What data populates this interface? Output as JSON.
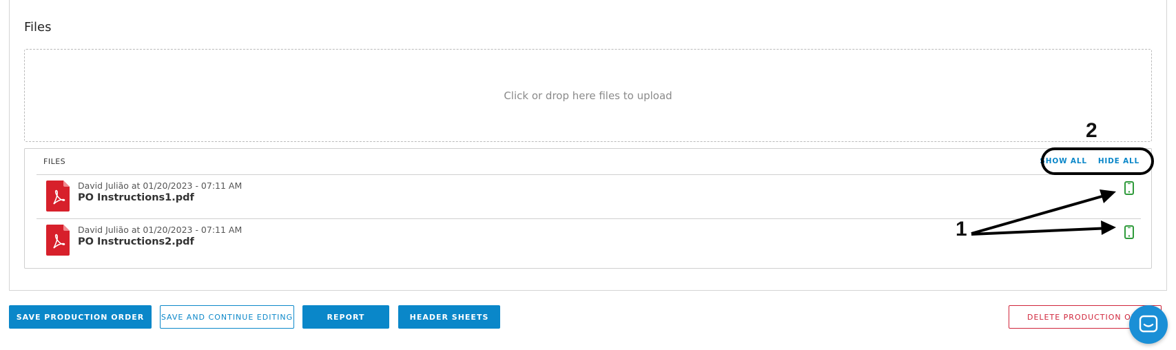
{
  "section": {
    "title": "Files"
  },
  "dropzone": {
    "text": "Click or drop here files to upload"
  },
  "files_panel": {
    "header_label": "FILES",
    "show_all_label": "SHOW ALL",
    "hide_all_label": "HIDE ALL",
    "files": [
      {
        "meta": "David Julião at 01/20/2023 - 07:11 AM",
        "name": "PO Instructions1.pdf",
        "icon": "pdf-icon",
        "visibility_icon": "mobile-phone-icon"
      },
      {
        "meta": "David Julião at 01/20/2023 - 07:11 AM",
        "name": "PO Instructions2.pdf",
        "icon": "pdf-icon",
        "visibility_icon": "mobile-phone-icon"
      }
    ]
  },
  "annotations": {
    "label_1": "1",
    "label_2": "2"
  },
  "footer": {
    "save_label": "SAVE PRODUCTION ORDER",
    "save_continue_label": "SAVE AND CONTINUE EDITING",
    "report_label": "REPORT",
    "header_sheets_label": "HEADER SHEETS",
    "delete_label": "DELETE PRODUCTION ORD"
  },
  "colors": {
    "accent": "#0a87c9",
    "danger": "#d0243a",
    "pdf_red": "#d7202b",
    "phone_green": "#2e9a3a",
    "chat_blue": "#1a8fd6"
  }
}
